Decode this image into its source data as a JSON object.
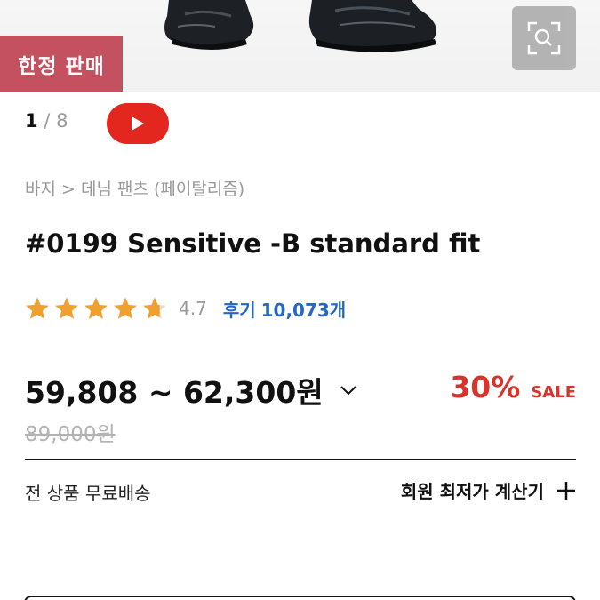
{
  "badge": {
    "limited_label": "한정 판매"
  },
  "gallery": {
    "current": "1",
    "separator": " / ",
    "total": "8"
  },
  "icons": {
    "zoom": "zoom-icon",
    "video": "play-icon",
    "star": "star-icon",
    "chevron": "chevron-down-icon",
    "plus": "plus-icon"
  },
  "breadcrumb": {
    "text": "바지 > 데님 팬츠 (페이탈리즘)"
  },
  "product": {
    "title": "#0199 Sensitive -B standard fit"
  },
  "rating": {
    "score": "4.7",
    "stars_filled": 4.7,
    "review_label": "후기",
    "review_count": "10,073개"
  },
  "price": {
    "range": "59,808 ~ 62,300원",
    "discount_rate": "30%",
    "sale_label": "SALE",
    "original": "89,000원"
  },
  "shipping": {
    "text": "전 상품 무료배송"
  },
  "member_price": {
    "label": "회원 최저가 계산기"
  },
  "colors": {
    "badge": "#c4515f",
    "video": "#e3261e",
    "review": "#2468c4",
    "discount": "#d8342c",
    "star": "#f0a02f"
  }
}
